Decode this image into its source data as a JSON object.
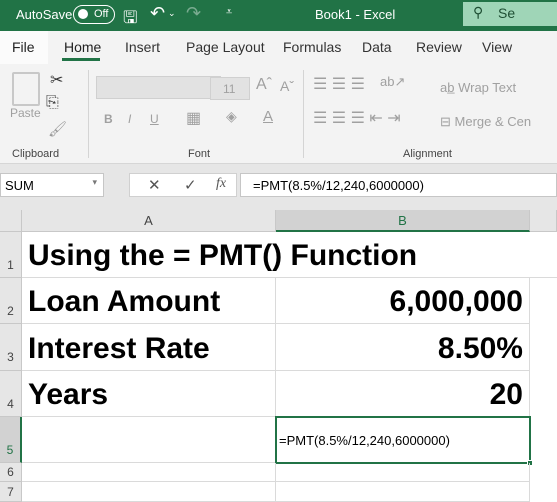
{
  "titlebar": {
    "autosave_label": "AutoSave",
    "autosave_state": "Off",
    "title": "Book1  -  Excel",
    "search": "Se"
  },
  "tabs": [
    "File",
    "Home",
    "Insert",
    "Page Layout",
    "Formulas",
    "Data",
    "Review",
    "View"
  ],
  "active_tab": "Home",
  "ribbon": {
    "paste": "Paste",
    "font_size": "11",
    "wrap_text": "Wrap Text",
    "merge": "Merge & Cen",
    "groups": [
      "Clipboard",
      "Font",
      "Alignment"
    ]
  },
  "formula_bar": {
    "name_box": "SUM",
    "formula": "=PMT(8.5%/12,240,6000000)"
  },
  "sheet": {
    "columns": [
      "A",
      "B"
    ],
    "rows": [
      "1",
      "2",
      "3",
      "4",
      "5",
      "6",
      "7"
    ],
    "cells": {
      "A1": "Using the = PMT() Function",
      "A2": "Loan Amount",
      "B2": "6,000,000",
      "A3": "Interest Rate",
      "B3": "8.50%",
      "A4": "Years",
      "B4": "20",
      "B5": "=PMT(8.5%/12,240,6000000)"
    }
  },
  "colors": {
    "accent": "#217346"
  }
}
